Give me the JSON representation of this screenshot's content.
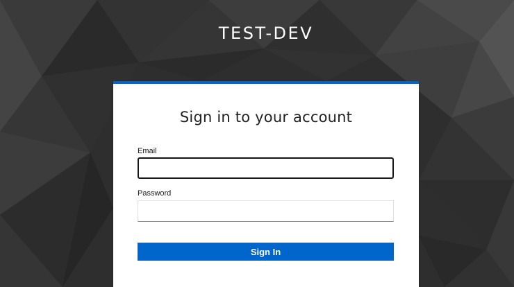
{
  "realm": {
    "title": "TEST-DEV"
  },
  "login": {
    "heading": "Sign in to your account",
    "email": {
      "label": "Email",
      "value": "",
      "placeholder": ""
    },
    "password": {
      "label": "Password",
      "value": "",
      "placeholder": ""
    },
    "submit_label": "Sign In"
  },
  "colors": {
    "accent": "#0066cc",
    "background": "#2e2e2e",
    "card": "#ffffff"
  }
}
